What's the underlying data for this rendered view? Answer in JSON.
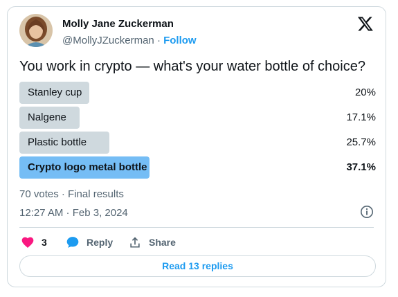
{
  "author": {
    "name": "Molly Jane Zuckerman",
    "handle": "@MollyJZuckerman",
    "separator": "·",
    "follow_label": "Follow"
  },
  "tweet": {
    "question": "You work in crypto — what's your water bottle of choice?"
  },
  "poll": {
    "options": [
      {
        "label": "Stanley cup",
        "percent_text": "20%",
        "percent": 20.0
      },
      {
        "label": "Nalgene",
        "percent_text": "17.1%",
        "percent": 17.1
      },
      {
        "label": "Plastic bottle",
        "percent_text": "25.7%",
        "percent": 25.7
      },
      {
        "label": "Crypto logo metal bottle",
        "percent_text": "37.1%",
        "percent": 37.1,
        "winner": true
      }
    ],
    "meta": "70 votes · Final results"
  },
  "timestamp": "12:27 AM · Feb 3, 2024",
  "actions": {
    "like_count": "3",
    "reply_label": "Reply",
    "share_label": "Share"
  },
  "read_replies_label": "Read 13 replies",
  "icons": {
    "logo": "x-logo-icon",
    "info": "info-icon",
    "like": "heart-icon",
    "reply": "speech-bubble-icon",
    "share": "share-icon"
  },
  "colors": {
    "accent": "#1d9bf0",
    "like": "#f91880",
    "winner_bar": "#75bdf5",
    "bar": "#cfd9de",
    "secondary_text": "#536471"
  }
}
